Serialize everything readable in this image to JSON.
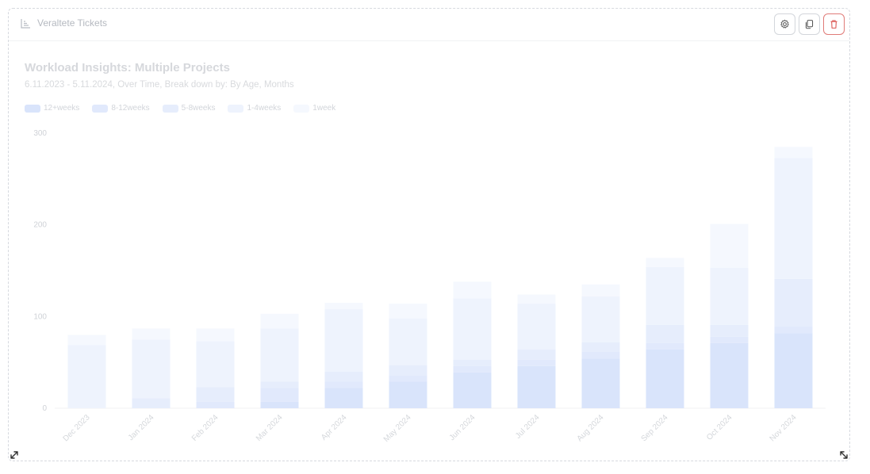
{
  "widget": {
    "title": "Veraltete Tickets",
    "header_icon": "bar-chart-icon",
    "toolbar": {
      "settings_icon": "gear-icon",
      "duplicate_icon": "copy-icon",
      "delete_icon": "trash-icon",
      "delete_color": "#d9534f"
    },
    "resize_icons": [
      "resize-diagonal-icon",
      "resize-diagonal-icon"
    ]
  },
  "chart_data": {
    "type": "bar",
    "stacked": true,
    "title": "Workload Insights: Multiple Projects",
    "subtitle": "6.11.2023 - 5.11.2024, Over Time, Break down by: By Age, Months",
    "categories": [
      "Dec 2023",
      "Jan 2024",
      "Feb 2024",
      "Mar 2024",
      "Apr 2024",
      "May 2024",
      "Jun 2024",
      "Jul 2024",
      "Aug 2024",
      "Sep 2024",
      "Oct 2024",
      "Nov 2024"
    ],
    "series": [
      {
        "name": "12+weeks",
        "color": "#d9e4fb",
        "values": [
          0,
          0,
          0,
          7,
          22,
          29,
          39,
          46,
          54,
          64,
          71,
          82
        ]
      },
      {
        "name": "8-12weeks",
        "color": "#e1e9fc",
        "values": [
          0,
          0,
          7,
          15,
          7,
          7,
          7,
          7,
          8,
          7,
          7,
          7
        ]
      },
      {
        "name": "5-8weeks",
        "color": "#e6edfc",
        "values": [
          0,
          11,
          16,
          7,
          11,
          11,
          7,
          11,
          10,
          20,
          13,
          52
        ]
      },
      {
        "name": "1-4weeks",
        "color": "#eef3fd",
        "values": [
          69,
          64,
          50,
          58,
          68,
          51,
          67,
          50,
          50,
          63,
          62,
          132
        ]
      },
      {
        "name": "1week",
        "color": "#f5f8fe",
        "values": [
          11,
          12,
          14,
          16,
          7,
          16,
          18,
          10,
          13,
          10,
          48,
          12
        ]
      }
    ],
    "ylim": [
      0,
      300
    ],
    "yticks": [
      0,
      100,
      200,
      300
    ],
    "grid": false,
    "legend_position": "top-left",
    "xlabel": "",
    "ylabel": ""
  }
}
